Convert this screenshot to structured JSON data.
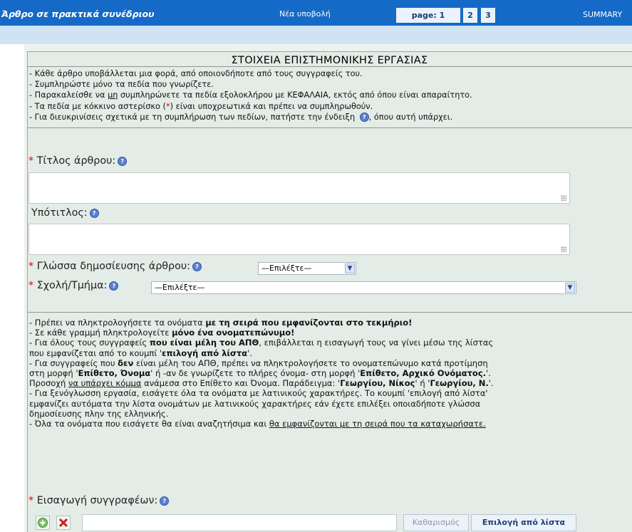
{
  "header": {
    "site_title": "Άρθρο σε πρακτικά συνέδριου",
    "new_submission": "Νέα υποβολή",
    "pages": [
      "page: 1",
      "2",
      "3"
    ],
    "summary": "SUMMARY"
  },
  "form": {
    "section_title": "ΣΤΟΙΧΕΙΑ ΕΠΙΣΤΗΜΟΝΙΚΗΣ ΕΡΓΑΣΙΑΣ",
    "notes": [
      "- Κάθε άρθρο υποβάλλεται μια φορά, από οποιονδήποτε από τους συγγραφείς του.",
      "- Συμπληρώστε μόνο τα πεδία που γνωρίζετε.",
      "- Παρακαλείσθε να ",
      "μη",
      " συμπληρώνετε τα πεδία εξολοκλήρου με ΚΕΦΑΛΑΙΑ, εκτός από όπου είναι απαραίτητο.",
      "- Τα πεδία με κόκκινο αστερίσκο (",
      "*",
      ") είναι υποχρεωτικά και πρέπει να συμπληρωθούν.",
      "- Για διευκρινίσεις σχετικά με τη συμπλήρωση των πεδίων, πατήστε την ένδειξη ",
      ", όπου αυτή υπάρχει."
    ],
    "required_mark": "*",
    "title_label": "Τίτλος άρθρου:",
    "subtitle_label": "Υπότιτλος:",
    "language_label": "Γλώσσα δημοσίευσης άρθρου:",
    "language_value": "—Επιλέξτε—",
    "school_label": "Σχολή/Τμήμα:",
    "school_value": "—Επιλέξτε—",
    "authors_label": "Εισαγωγή συγγραφέων:",
    "clear_button": "Καθαρισμός",
    "select_from_list_button": "Επιλογή από λίστα"
  },
  "authors_instructions": {
    "l1a": "- Πρέπει να πληκτρολογήσετε τα ονόματα ",
    "l1b": "με τη σειρά που εμφανίζονται στο τεκμήριο!",
    "l2a": "- Σε κάθε γραμμή πληκτρολογείτε ",
    "l2b": "μόνο ένα ονοματεπώνυμο!",
    "l3a": "- Για όλους τους συγγραφείς ",
    "l3b": "που είναι μέλη του ΑΠΘ",
    "l3c": ", επιβάλλεται η εισαγωγή τους να γίνει μέσω της λίστας",
    "l4a": "που εμφανίζεται από το κουμπί '",
    "l4b": "επιλογή από λίστα",
    "l4c": "'.",
    "l5a": "- Για συγγραφείς που ",
    "l5b": "δεν",
    "l5c": " είναι μέλη του ΑΠΘ, πρέπει να πληκτρολογήσετε το ονοματεπώνυμο κατά προτίμηση",
    "l6a": "στη μορφή '",
    "l6b": "Επίθετο, Όνομα",
    "l6c": "' ή -αν δε γνωρίζετε το πλήρες όνομα- στη μορφή '",
    "l6d": "Επίθετο, Αρχικό Ονόματος.",
    "l6e": "'.",
    "l7a": "Προσοχή ",
    "l7b": "να υπάρχει κόμμα",
    "l7c": " ανάμεσα στο Επίθετο και Όνομα. Παράδειγμα: '",
    "l7d": "Γεωργίου, Νίκος",
    "l7e": "' ή '",
    "l7f": "Γεωργίου, Ν.",
    "l7g": "'.",
    "l8": "- Για ξενόγλωσση εργασία, εισάγετε όλα τα ονόματα με λατινικούς χαρακτήρες. Το κουμπί 'επιλογή από λίστα'",
    "l9": "εμφανίζει αυτόματα την λίστα ονομάτων με λατινικούς χαρακτήρες εάν έχετε επιλέξει οποιαδήποτε γλώσσα",
    "l10": "δημοσίευσης πλην της ελληνικής.",
    "l11a": "- Όλα τα ονόματα που εισάγετε θα είναι αναζητήσιμα και ",
    "l11b": "θα εμφανίζονται με τη σειρά που τα καταχωρήσατε."
  },
  "colors": {
    "header_bg": "#1569c7",
    "panel_bg": "#e4ece7",
    "required": "#e10000"
  }
}
